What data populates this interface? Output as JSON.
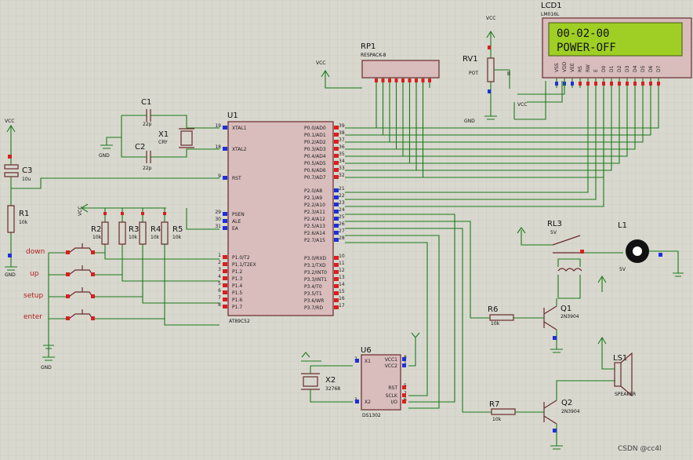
{
  "lcd": {
    "ref": "LCD1",
    "part": "LM016L",
    "line1": "00-02-00",
    "line2": "POWER-OFF",
    "pins": [
      "VSS",
      "VDD",
      "VEE",
      "RS",
      "RW",
      "E",
      "D0",
      "D1",
      "D2",
      "D3",
      "D4",
      "D5",
      "D6",
      "D7"
    ]
  },
  "mcu": {
    "ref": "U1",
    "part": "AT89C52",
    "left_pins": [
      [
        "19",
        "XTAL1"
      ],
      [
        "18",
        "XTAL2"
      ],
      [
        "9",
        "RST"
      ],
      [
        "29",
        "PSEN"
      ],
      [
        "30",
        "ALE"
      ],
      [
        "31",
        "EA"
      ],
      [
        "1",
        "P1.0/T2"
      ],
      [
        "2",
        "P1.1/T2EX"
      ],
      [
        "3",
        "P1.2"
      ],
      [
        "4",
        "P1.3"
      ],
      [
        "5",
        "P1.4"
      ],
      [
        "6",
        "P1.5"
      ],
      [
        "7",
        "P1.6"
      ],
      [
        "8",
        "P1.7"
      ]
    ],
    "right_pins": [
      [
        "39",
        "P0.0/AD0"
      ],
      [
        "38",
        "P0.1/AD1"
      ],
      [
        "37",
        "P0.2/AD2"
      ],
      [
        "36",
        "P0.3/AD3"
      ],
      [
        "35",
        "P0.4/AD4"
      ],
      [
        "34",
        "P0.5/AD5"
      ],
      [
        "33",
        "P0.6/AD6"
      ],
      [
        "32",
        "P0.7/AD7"
      ],
      [
        "21",
        "P2.0/A8"
      ],
      [
        "22",
        "P2.1/A9"
      ],
      [
        "23",
        "P2.2/A10"
      ],
      [
        "24",
        "P2.3/A11"
      ],
      [
        "25",
        "P2.4/A12"
      ],
      [
        "26",
        "P2.5/A13"
      ],
      [
        "27",
        "P2.6/A14"
      ],
      [
        "28",
        "P2.7/A15"
      ],
      [
        "10",
        "P3.0/RXD"
      ],
      [
        "11",
        "P3.1/TXD"
      ],
      [
        "12",
        "P3.2/INT0"
      ],
      [
        "13",
        "P3.3/INT1"
      ],
      [
        "14",
        "P3.4/T0"
      ],
      [
        "15",
        "P3.5/T1"
      ],
      [
        "16",
        "P3.6/WR"
      ],
      [
        "17",
        "P3.7/RD"
      ]
    ]
  },
  "components": {
    "rp1": {
      "ref": "RP1",
      "part": "RESPACK-8"
    },
    "rv1": {
      "ref": "RV1",
      "part": "POT"
    },
    "c1": {
      "ref": "C1",
      "value": "22p"
    },
    "c2": {
      "ref": "C2",
      "value": "22p"
    },
    "c3": {
      "ref": "C3",
      "value": "10u"
    },
    "x1": {
      "ref": "X1",
      "part": "CRY"
    },
    "x2": {
      "ref": "X2",
      "value": "32768"
    },
    "r1": {
      "ref": "R1",
      "value": "10k"
    },
    "r2": {
      "ref": "R2",
      "value": "10k"
    },
    "r3": {
      "ref": "R3",
      "value": "10k"
    },
    "r4": {
      "ref": "R4",
      "value": "10k"
    },
    "r5": {
      "ref": "R5",
      "value": "10k"
    },
    "r6": {
      "ref": "R6",
      "value": "10k"
    },
    "r7": {
      "ref": "R7",
      "value": "10k"
    },
    "q1": {
      "ref": "Q1",
      "part": "2N3904"
    },
    "q2": {
      "ref": "Q2",
      "part": "2N3904"
    },
    "rl3": {
      "ref": "RL3",
      "value": "5V"
    },
    "l1": {
      "ref": "L1",
      "value": "5V"
    },
    "ls1": {
      "ref": "LS1",
      "part": "SPEAKER"
    },
    "u6": {
      "ref": "U6",
      "part": "DS1302",
      "pins_left": [
        [
          "2",
          "X1"
        ],
        [
          "3",
          "X2"
        ]
      ],
      "pins_right": [
        [
          "8",
          "VCC1"
        ],
        [
          "1",
          "VCC2"
        ],
        [
          "5",
          "RST"
        ],
        [
          "7",
          "SCLK"
        ],
        [
          "6",
          "I/O"
        ]
      ]
    }
  },
  "buttons": {
    "down": "down",
    "up": "up",
    "setup": "setup",
    "enter": "enter"
  },
  "power": {
    "vcc": "VCC",
    "gnd": "GND"
  },
  "watermark": "CSDN @cc4l"
}
